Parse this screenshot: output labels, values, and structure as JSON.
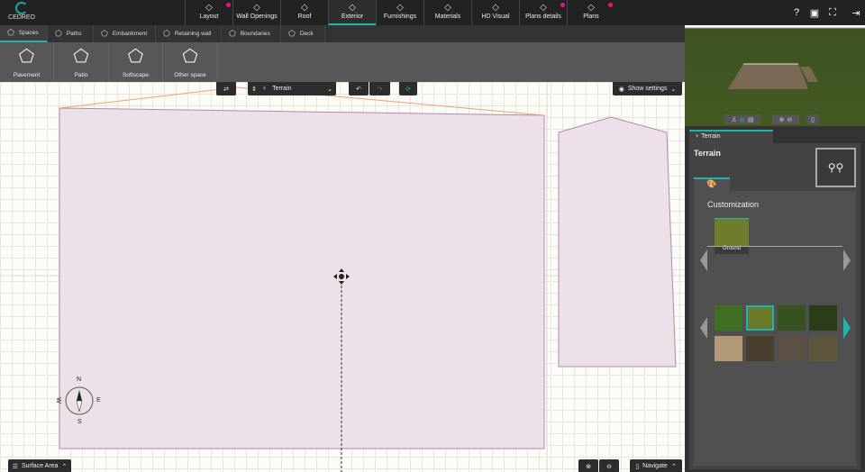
{
  "app": {
    "logo_text": "CEDREO"
  },
  "main_tabs": [
    {
      "label": "Layout",
      "icon": "pencil-icon",
      "dot": true
    },
    {
      "label": "Wall Openings",
      "icon": "door-icon",
      "dot": false
    },
    {
      "label": "Roof",
      "icon": "roof-icon",
      "dot": false
    },
    {
      "label": "Exterior",
      "icon": "exterior-icon",
      "dot": false,
      "active": true
    },
    {
      "label": "Furnishings",
      "icon": "furniture-icon",
      "dot": false
    },
    {
      "label": "Materials",
      "icon": "paint-roller-icon",
      "dot": false
    },
    {
      "label": "HD Visual",
      "icon": "camera-icon",
      "dot": false
    },
    {
      "label": "Plans details",
      "icon": "tag-icon",
      "dot": true
    },
    {
      "label": "Plans",
      "icon": "plans-icon",
      "dot": true
    }
  ],
  "top_right": [
    "help-icon",
    "save-icon",
    "fullscreen-icon",
    "exit-icon"
  ],
  "sub_tabs": [
    {
      "label": "Spaces"
    },
    {
      "label": "Paths"
    },
    {
      "label": "Embankment"
    },
    {
      "label": "Retaining wall"
    },
    {
      "label": "Boundaries"
    },
    {
      "label": "Deck"
    }
  ],
  "tools": [
    {
      "label": "Pavement"
    },
    {
      "label": "Patio"
    },
    {
      "label": "Softscape"
    },
    {
      "label": "Other space"
    }
  ],
  "toolbar": {
    "level_select": "Terrain",
    "show_settings": "Show settings"
  },
  "compass": {
    "n": "N",
    "s": "S",
    "e": "E",
    "w": "W"
  },
  "bottom": {
    "surface_area": "Surface Area",
    "navigate": "Navigate"
  },
  "panel": {
    "tab_label": "Terrain",
    "title": "Terrain",
    "section": "Customization",
    "selected_material": "Ground",
    "swatches": [
      "#3f6e23",
      "#6b7a2a",
      "#35521f",
      "#2a3d18",
      "#b29a78",
      "#4a3e2e",
      "#5c4f44",
      "#5e563c"
    ],
    "selected_swatch": 1,
    "accent": "#1fb5ad"
  }
}
